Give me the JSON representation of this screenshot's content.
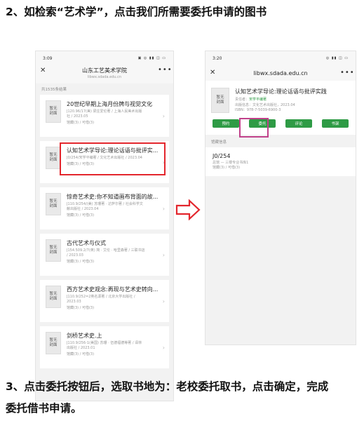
{
  "instructions": {
    "step2": "2、如检索“艺术学”，点击我们所需要委托申请的图书",
    "step3_line1": "3、点击委托按钮后，选取书地为：老校委托取书，点击确定，完成",
    "step3_line2": "委托借书申请。"
  },
  "phone1": {
    "time": "3:09",
    "status_icons": "▣ ◎ ▮▮ ◫ ▭",
    "close_icon": "✕",
    "title": "山东工艺美术学院",
    "url": "libwx.sdada.edu.cn",
    "more_icon": "•••",
    "result_count": "共1535条结果",
    "books": [
      {
        "cover_line1": "暂无",
        "cover_line2": "封面",
        "title": "20世纪早期上海月份牌与视觉文化",
        "meta1": "J120.96/17(美) 梁庄爱伦著 / 上海人民美术出版",
        "meta2": "社 / 2023.05",
        "status": "馆藏(3) / 可借(3)"
      },
      {
        "cover_line1": "暂无",
        "cover_line2": "封面",
        "title": "认知艺术学导论:理论话语与批评实...",
        "meta1": "J0/254/宋学平编著 / 文化艺术出版社 / 2023.04",
        "meta2": "",
        "status": "馆藏(3) / 可借(3)"
      },
      {
        "cover_line1": "暂无",
        "cover_line2": "封面",
        "title": "惊奇艺术史:你不知道画布背面的故...",
        "meta1": "J110.9/254/(美) 苏珊著 · 达萨尔著 / 社会科学文",
        "meta2": "献出版社 / 2023.04",
        "status": "馆藏(3) / 可借(3)"
      },
      {
        "cover_line1": "暂无",
        "cover_line2": "封面",
        "title": "古代艺术与仪式",
        "meta1": "J154.509.2/7(英) 简 · 艾伦 · 哈里森著 / 三联书店",
        "meta2": "/ 2023.03",
        "status": "馆藏(3) / 可借(3)"
      },
      {
        "cover_line1": "暂无",
        "cover_line2": "封面",
        "title": "西方艺术史观念:再现与艺术史转向...",
        "meta1": "J110.9/252=2英名源著 / 北京大学出版社 /",
        "meta2": "2023.03",
        "status": "馆藏(3) / 可借(3)"
      },
      {
        "cover_line1": "暂无",
        "cover_line2": "封面",
        "title": "剑桥艺术史.上",
        "meta1": "J110.9/256-1(美国) 苏珊 · 伍德福德等著 / 译林",
        "meta2": "出版社 / 2023.01",
        "status": "馆藏(3) / 可借(3)"
      }
    ],
    "chevron": "›"
  },
  "phone2": {
    "time": "3:20",
    "status_icons": "◎ ▮▮ ◫ ▭",
    "close_icon": "✕",
    "url": "libwx.sdada.edu.cn",
    "more_icon": "•••",
    "book": {
      "cover_line1": "暂无",
      "cover_line2": "封面",
      "title": "认知艺术学导论:理论话语与批评实践",
      "author_label": "责任者：",
      "author_value": "宋学平编著",
      "publisher": "出版信息：文化艺术出版社，2023.04",
      "isbn": "ISBN：978-7-5039-6900-3"
    },
    "buttons": [
      "预约",
      "委托",
      "评论",
      "书架"
    ],
    "holdings_label": "馆藏信息",
    "holding": {
      "call_number": "J0/254",
      "location": "总馆 — 三楼专业书库1",
      "status": "馆藏(3) / 可借(3)"
    }
  },
  "colors": {
    "highlight_red": "#e3262d",
    "highlight_magenta": "#c0418a",
    "button_green": "#2e9b45"
  }
}
